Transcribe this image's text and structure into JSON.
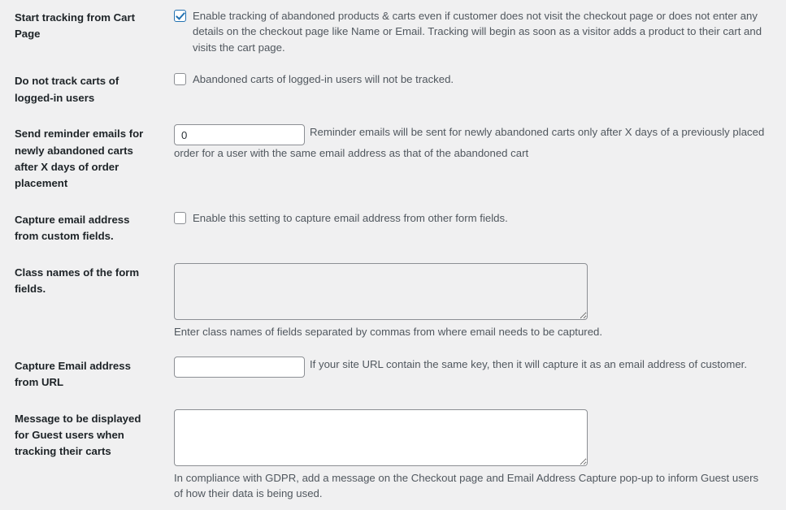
{
  "page": {
    "background": "#f0f0f1",
    "label_color": "#1d2327",
    "desc_color": "#50575e",
    "accent": "#2271b1"
  },
  "rows": [
    {
      "label": "Start tracking from Cart Page",
      "control": "checkbox",
      "checked": true,
      "desc": "Enable tracking of abandoned products & carts even if customer does not visit the checkout page or does not enter any details on the checkout page like Name or Email. Tracking will begin as soon as a visitor adds a product to their cart and visits the cart page."
    },
    {
      "label": "Do not track carts of logged-in users",
      "control": "checkbox",
      "checked": false,
      "desc": "Abandoned carts of logged-in users will not be tracked."
    },
    {
      "label": "Send reminder emails for newly abandoned carts after X days of order placement",
      "control": "number",
      "value": "0",
      "desc": "Reminder emails will be sent for newly abandoned carts only after X days of a previously placed order for a user with the same email address as that of the abandoned cart"
    },
    {
      "label": "Capture email address from custom fields.",
      "control": "checkbox",
      "checked": false,
      "desc": "Enable this setting to capture email address from other form fields."
    },
    {
      "label": "Class names of the form fields.",
      "control": "textarea",
      "value": "",
      "disabled": true,
      "desc": "Enter class names of fields separated by commas from where email needs to be captured."
    },
    {
      "label": "Capture Email address from URL",
      "control": "text",
      "value": "",
      "desc": "If your site URL contain the same key, then it will capture it as an email address of customer."
    },
    {
      "label": "Message to be displayed for Guest users when tracking their carts",
      "control": "textarea",
      "value": "",
      "disabled": false,
      "desc": "In compliance with GDPR, add a message on the Checkout page and Email Address Capture pop-up to inform Guest users of how their data is being used."
    }
  ]
}
